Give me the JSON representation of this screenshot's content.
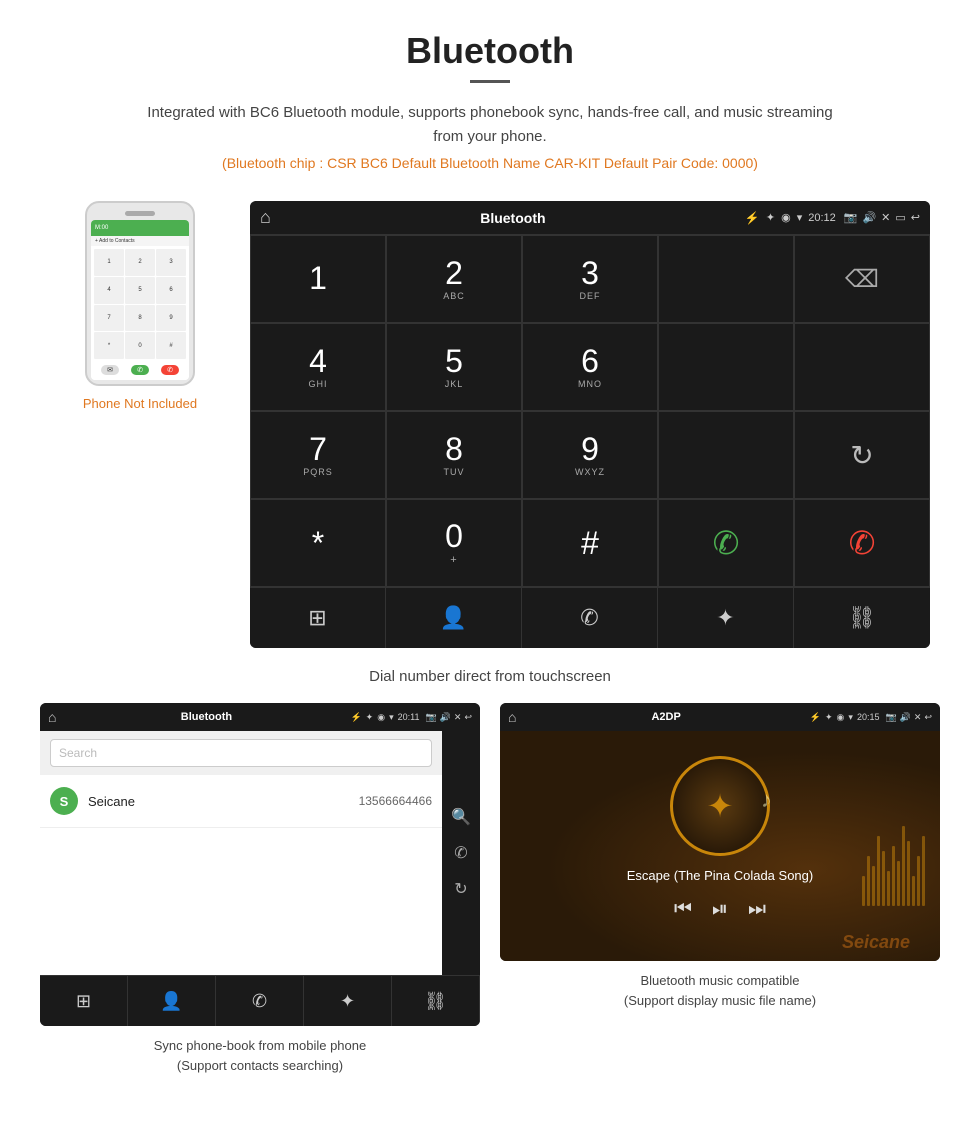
{
  "header": {
    "title": "Bluetooth",
    "description": "Integrated with BC6 Bluetooth module, supports phonebook sync, hands-free call, and music streaming from your phone.",
    "specs": "(Bluetooth chip : CSR BC6    Default Bluetooth Name CAR-KIT    Default Pair Code: 0000)"
  },
  "phone_label": "Phone Not Included",
  "dialpad": {
    "title": "Bluetooth",
    "status_time": "20:12",
    "keys": [
      {
        "main": "1",
        "sub": ""
      },
      {
        "main": "2",
        "sub": "ABC"
      },
      {
        "main": "3",
        "sub": "DEF"
      },
      {
        "main": "",
        "sub": ""
      },
      {
        "main": "⌫",
        "sub": ""
      },
      {
        "main": "4",
        "sub": "GHI"
      },
      {
        "main": "5",
        "sub": "JKL"
      },
      {
        "main": "6",
        "sub": "MNO"
      },
      {
        "main": "",
        "sub": ""
      },
      {
        "main": "",
        "sub": ""
      },
      {
        "main": "7",
        "sub": "PQRS"
      },
      {
        "main": "8",
        "sub": "TUV"
      },
      {
        "main": "9",
        "sub": "WXYZ"
      },
      {
        "main": "",
        "sub": ""
      },
      {
        "main": "↻",
        "sub": ""
      },
      {
        "main": "*",
        "sub": ""
      },
      {
        "main": "0",
        "sub": "+"
      },
      {
        "main": "#",
        "sub": ""
      },
      {
        "main": "✆",
        "sub": ""
      },
      {
        "main": "",
        "sub": ""
      },
      {
        "main": "⊞",
        "sub": ""
      },
      {
        "main": "👤",
        "sub": ""
      },
      {
        "main": "✆",
        "sub": ""
      },
      {
        "main": "✦",
        "sub": ""
      },
      {
        "main": "🔗",
        "sub": ""
      }
    ],
    "caption": "Dial number direct from touchscreen"
  },
  "contacts_screen": {
    "title": "Bluetooth",
    "status_time": "20:11",
    "search_placeholder": "Search",
    "contact": {
      "initial": "S",
      "name": "Seicane",
      "phone": "13566664466"
    },
    "caption_line1": "Sync phone-book from mobile phone",
    "caption_line2": "(Support contacts searching)"
  },
  "music_screen": {
    "title": "A2DP",
    "status_time": "20:15",
    "song_title": "Escape (The Pina Colada Song)",
    "caption_line1": "Bluetooth music compatible",
    "caption_line2": "(Support display music file name)"
  },
  "watermark": "Seicane",
  "icons": {
    "home": "⌂",
    "usb": "⚡",
    "bluetooth": "⚡",
    "location": "◉",
    "wifi": "▾",
    "camera": "📷",
    "volume": "🔊",
    "close": "✕",
    "back": "↩",
    "grid": "⊞",
    "person": "👤",
    "phone": "✆",
    "bt": "✦",
    "link": "⛓",
    "search": "🔍",
    "refresh": "↻",
    "prev": "⏮",
    "playpause": "⏯",
    "next": "⏭",
    "music_note": "♪"
  }
}
